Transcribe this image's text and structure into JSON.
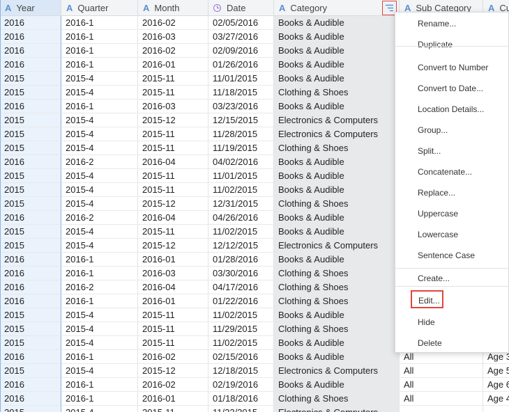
{
  "columns": [
    {
      "key": "year",
      "label": "Year",
      "type_icon": "text-type-icon"
    },
    {
      "key": "quarter",
      "label": "Quarter",
      "type_icon": "text-type-icon"
    },
    {
      "key": "month",
      "label": "Month",
      "type_icon": "text-type-icon"
    },
    {
      "key": "date",
      "label": "Date",
      "type_icon": "date-type-icon"
    },
    {
      "key": "category",
      "label": "Category",
      "type_icon": "text-type-icon"
    },
    {
      "key": "sub_category",
      "label": "Sub Category",
      "type_icon": "text-type-icon"
    },
    {
      "key": "cu",
      "label": "Cu",
      "type_icon": "text-type-icon"
    }
  ],
  "rows": [
    [
      "2016",
      "2016-1",
      "2016-02",
      "02/05/2016",
      "Books & Audible",
      "",
      ""
    ],
    [
      "2016",
      "2016-1",
      "2016-03",
      "03/27/2016",
      "Books & Audible",
      "",
      ""
    ],
    [
      "2016",
      "2016-1",
      "2016-02",
      "02/09/2016",
      "Books & Audible",
      "",
      ""
    ],
    [
      "2016",
      "2016-1",
      "2016-01",
      "01/26/2016",
      "Books & Audible",
      "",
      ""
    ],
    [
      "2015",
      "2015-4",
      "2015-11",
      "11/01/2015",
      "Books & Audible",
      "",
      ""
    ],
    [
      "2015",
      "2015-4",
      "2015-11",
      "11/18/2015",
      "Clothing & Shoes",
      "",
      ""
    ],
    [
      "2016",
      "2016-1",
      "2016-03",
      "03/23/2016",
      "Books & Audible",
      "",
      ""
    ],
    [
      "2015",
      "2015-4",
      "2015-12",
      "12/15/2015",
      "Electronics & Computers",
      "",
      ""
    ],
    [
      "2015",
      "2015-4",
      "2015-11",
      "11/28/2015",
      "Electronics & Computers",
      "",
      ""
    ],
    [
      "2015",
      "2015-4",
      "2015-11",
      "11/19/2015",
      "Clothing & Shoes",
      "",
      ""
    ],
    [
      "2016",
      "2016-2",
      "2016-04",
      "04/02/2016",
      "Books & Audible",
      "",
      ""
    ],
    [
      "2015",
      "2015-4",
      "2015-11",
      "11/01/2015",
      "Books & Audible",
      "",
      ""
    ],
    [
      "2015",
      "2015-4",
      "2015-11",
      "11/02/2015",
      "Books & Audible",
      "",
      ""
    ],
    [
      "2015",
      "2015-4",
      "2015-12",
      "12/31/2015",
      "Clothing & Shoes",
      "",
      ""
    ],
    [
      "2016",
      "2016-2",
      "2016-04",
      "04/26/2016",
      "Books & Audible",
      "",
      ""
    ],
    [
      "2015",
      "2015-4",
      "2015-11",
      "11/02/2015",
      "Books & Audible",
      "",
      ""
    ],
    [
      "2015",
      "2015-4",
      "2015-12",
      "12/12/2015",
      "Electronics & Computers",
      "",
      ""
    ],
    [
      "2016",
      "2016-1",
      "2016-01",
      "01/28/2016",
      "Books & Audible",
      "",
      ""
    ],
    [
      "2016",
      "2016-1",
      "2016-03",
      "03/30/2016",
      "Clothing & Shoes",
      "",
      ""
    ],
    [
      "2016",
      "2016-2",
      "2016-04",
      "04/17/2016",
      "Clothing & Shoes",
      "",
      ""
    ],
    [
      "2016",
      "2016-1",
      "2016-01",
      "01/22/2016",
      "Clothing & Shoes",
      "",
      ""
    ],
    [
      "2015",
      "2015-4",
      "2015-11",
      "11/02/2015",
      "Books & Audible",
      "",
      ""
    ],
    [
      "2015",
      "2015-4",
      "2015-11",
      "11/29/2015",
      "Clothing & Shoes",
      "",
      ""
    ],
    [
      "2015",
      "2015-4",
      "2015-11",
      "11/02/2015",
      "Books & Audible",
      "",
      ""
    ],
    [
      "2016",
      "2016-1",
      "2016-02",
      "02/15/2016",
      "Books & Audible",
      "All",
      "Age 3"
    ],
    [
      "2015",
      "2015-4",
      "2015-12",
      "12/18/2015",
      "Electronics & Computers",
      "All",
      "Age 5"
    ],
    [
      "2016",
      "2016-1",
      "2016-02",
      "02/19/2016",
      "Books & Audible",
      "All",
      "Age 6"
    ],
    [
      "2016",
      "2016-1",
      "2016-01",
      "01/18/2016",
      "Clothing & Shoes",
      "All",
      "Age 4"
    ],
    [
      "2015",
      "2015-4",
      "2015-11",
      "11/22/2015",
      "Electronics & Computers",
      "",
      ""
    ]
  ],
  "context_menu": {
    "items": [
      {
        "label": "Rename...",
        "name": "menu-item-rename"
      },
      {
        "label": "Duplicate",
        "name": "menu-item-duplicate"
      },
      {
        "label": "Convert to Number",
        "name": "menu-item-convert-to-number"
      },
      {
        "label": "Convert to Date...",
        "name": "menu-item-convert-to-date"
      },
      {
        "label": "Location Details...",
        "name": "menu-item-location-details"
      },
      {
        "label": "Group...",
        "name": "menu-item-group"
      },
      {
        "label": "Split...",
        "name": "menu-item-split"
      },
      {
        "label": "Concatenate...",
        "name": "menu-item-concatenate"
      },
      {
        "label": "Replace...",
        "name": "menu-item-replace"
      },
      {
        "label": "Uppercase",
        "name": "menu-item-uppercase"
      },
      {
        "label": "Lowercase",
        "name": "menu-item-lowercase"
      },
      {
        "label": "Sentence Case",
        "name": "menu-item-sentence-case"
      },
      {
        "label": "Create...",
        "name": "menu-item-create"
      },
      {
        "label": "Edit...",
        "name": "menu-item-edit"
      },
      {
        "label": "Hide",
        "name": "menu-item-hide"
      },
      {
        "label": "Delete",
        "name": "menu-item-delete"
      }
    ]
  },
  "colors": {
    "selected_column": "#d9e7f6",
    "text_type_icon": "#5b8fd1",
    "date_type_icon": "#9b76d6",
    "highlight_box": "#e2453c"
  }
}
